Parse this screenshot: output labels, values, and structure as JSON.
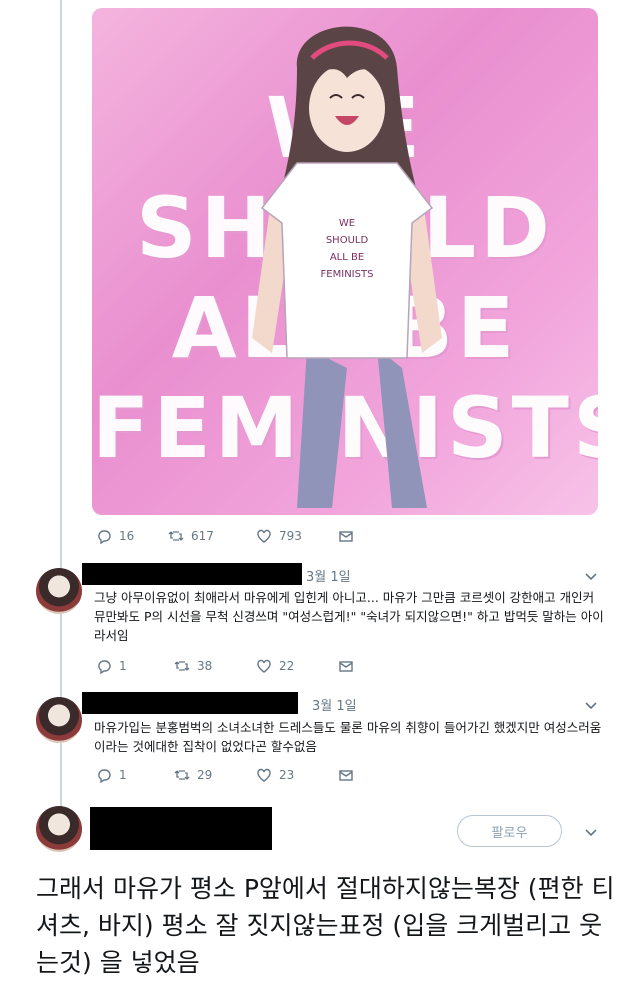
{
  "main_tweet": {
    "image_text": [
      "WE",
      "SHOULD",
      "ALL BE",
      "FEMINISTS"
    ],
    "shirt_text": [
      "WE",
      "SHOULD",
      "ALL BE",
      "FEMINISTS"
    ],
    "actions": {
      "replies": "16",
      "retweets": "617",
      "likes": "793"
    }
  },
  "replies": [
    {
      "date": "3월 1일",
      "text": "그냥 아무이유없이 최애라서 마유에게 입힌게 아니고... 마유가 그만큼 코르셋이 강한애고 개인커뮤만봐도 P의 시선을 무척 신경쓰며 \"여성스럽게!\" \"숙녀가 되지않으면!\" 하고 밥먹듯 말하는 아이라서임",
      "actions": {
        "replies": "1",
        "retweets": "38",
        "likes": "22"
      }
    },
    {
      "date": "3월 1일",
      "text": "마유가입는 분홍범벅의 소녀소녀한 드레스들도 물론 마유의 취향이 들어가긴 했겠지만 여성스러움이라는 것에대한 집착이 없었다곤 할수없음",
      "actions": {
        "replies": "1",
        "retweets": "29",
        "likes": "23"
      }
    }
  ],
  "follow": {
    "label": "팔로우"
  },
  "caption": "그래서 마유가 평소 P앞에서 절대하지않는복장 (편한 티셔츠, 바지) 평소 잘 짓지않는표정 (입을 크게벌리고 웃는것) 을 넣었음",
  "colors": {
    "accent": "#1da1f2",
    "muted": "#657786",
    "line": "#ccd6dd",
    "image_bg": "#ee9fd6"
  }
}
